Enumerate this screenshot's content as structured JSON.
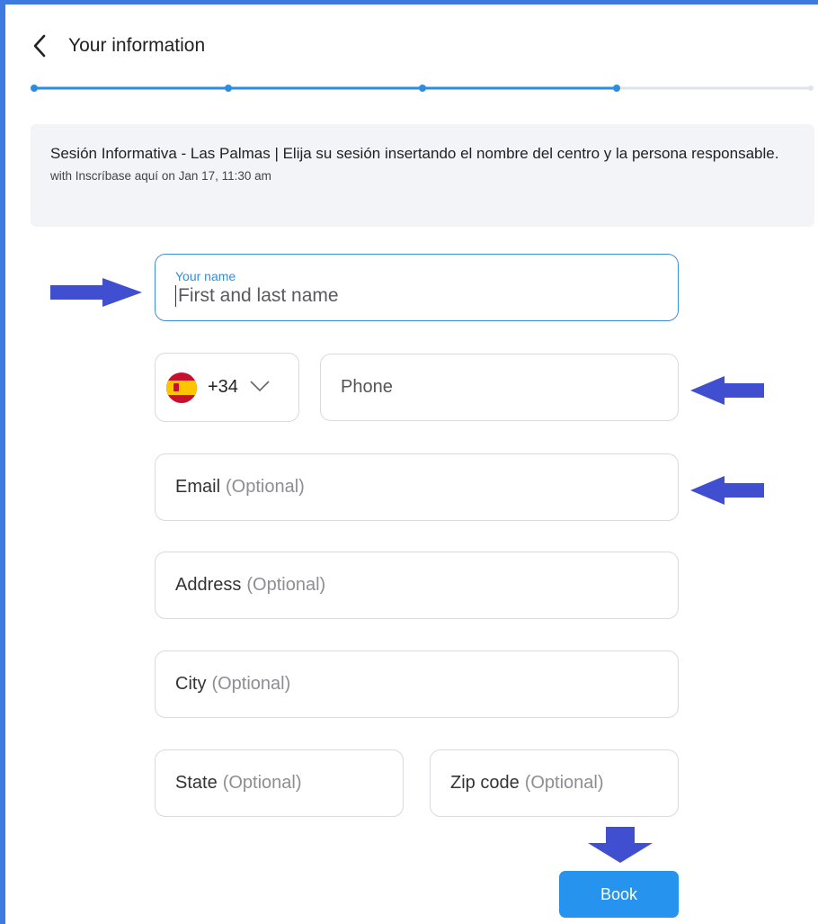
{
  "header": {
    "title": "Your information"
  },
  "progress": {
    "steps_completed": 4,
    "steps_total": 5,
    "accent": "#2b8de0",
    "track": "#dfe3ea"
  },
  "booking_info": {
    "title": "Sesión Informativa - Las Palmas | Elija su sesión insertando el nombre del centro y la persona responsable.",
    "subtitle": "with Inscríbase aquí on Jan 17, 11:30 am"
  },
  "form": {
    "name": {
      "label": "Your name",
      "placeholder": "First and last name"
    },
    "country": {
      "code": "+34",
      "flag_icon": "spain-flag-icon"
    },
    "phone": {
      "placeholder": "Phone"
    },
    "email": {
      "label": "Email",
      "optional": "(Optional)"
    },
    "address": {
      "label": "Address",
      "optional": "(Optional)"
    },
    "city": {
      "label": "City",
      "optional": "(Optional)"
    },
    "state": {
      "label": "State",
      "optional": "(Optional)"
    },
    "zip": {
      "label": "Zip code",
      "optional": "(Optional)"
    },
    "submit_label": "Book"
  },
  "colors": {
    "frame": "#3d7be0",
    "annotation_arrow": "#3f4fd0",
    "button": "#2694ee"
  }
}
